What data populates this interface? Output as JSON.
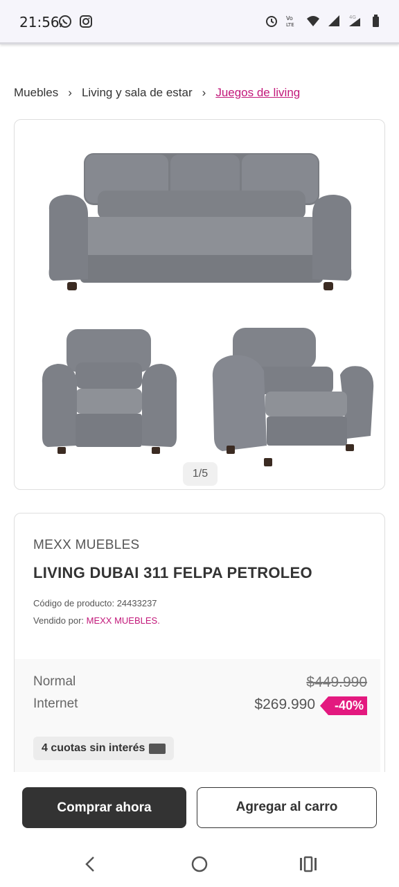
{
  "status_bar": {
    "time": "21:56",
    "left_icons": [
      "whatsapp-icon",
      "instagram-icon"
    ],
    "right_icons": [
      "alarm-icon",
      "volte-icon",
      "wifi-icon",
      "signal-icon",
      "signal-4g-icon",
      "battery-icon"
    ]
  },
  "breadcrumb": {
    "items": [
      "Muebles",
      "Living y sala de estar",
      "Juegos de living"
    ]
  },
  "gallery": {
    "counter": "1/5"
  },
  "product": {
    "brand": "MEXX MUEBLES",
    "title": "LIVING DUBAI 311 FELPA PETROLEO",
    "code_text": "Código de producto: 24433237",
    "seller_label": "Vendido por: ",
    "seller_name": "MEXX MUEBLES."
  },
  "prices": {
    "normal_label": "Normal",
    "normal_value": "$449.990",
    "internet_label": "Internet",
    "internet_value": "$269.990",
    "discount": "-40%",
    "installments": "4 cuotas sin interés"
  },
  "actions": {
    "buy_label": "Comprar ahora",
    "cart_label": "Agregar al carro"
  },
  "colors": {
    "accent": "#c2187a",
    "discount_badge": "#e3197f",
    "primary_button": "#333333"
  }
}
